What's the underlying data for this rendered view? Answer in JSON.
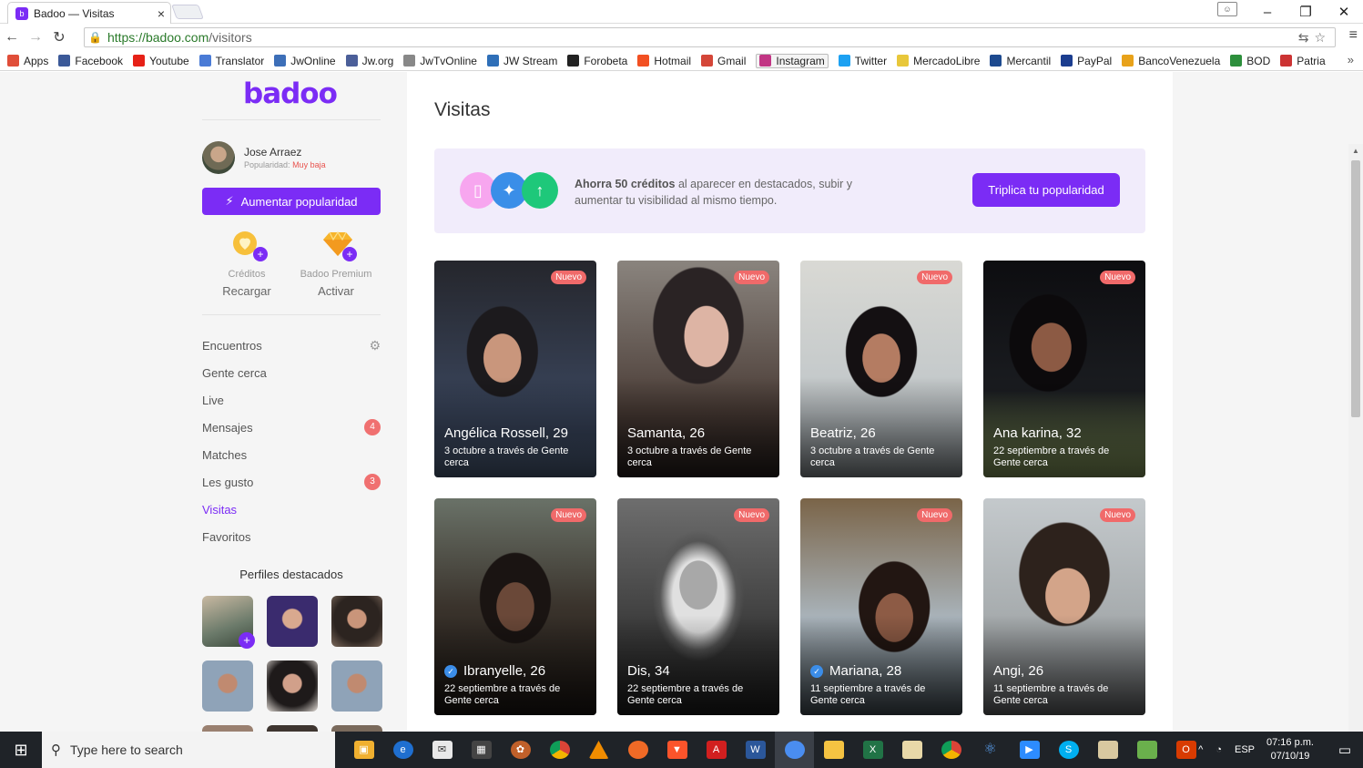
{
  "browser": {
    "tab_title": "Badoo — Visitas",
    "url_host": "https://badoo.com",
    "url_path": "/visitors",
    "bookmarks": [
      {
        "label": "Apps",
        "color": "#e04e39"
      },
      {
        "label": "Facebook",
        "color": "#3b5998"
      },
      {
        "label": "Youtube",
        "color": "#e62117"
      },
      {
        "label": "Translator",
        "color": "#4a7bd6"
      },
      {
        "label": "JwOnline",
        "color": "#3d6fb8"
      },
      {
        "label": "Jw.org",
        "color": "#4b5f99"
      },
      {
        "label": "JwTvOnline",
        "color": "#888888"
      },
      {
        "label": "JW Stream",
        "color": "#2f6fb8"
      },
      {
        "label": "Forobeta",
        "color": "#222222"
      },
      {
        "label": "Hotmail",
        "color": "#f25022"
      },
      {
        "label": "Gmail",
        "color": "#d44638"
      },
      {
        "label": "Instagram",
        "color": "#c13584"
      },
      {
        "label": "Twitter",
        "color": "#1da1f2"
      },
      {
        "label": "MercadoLibre",
        "color": "#e8c73a"
      },
      {
        "label": "Mercantil",
        "color": "#1d4a8f"
      },
      {
        "label": "PayPal",
        "color": "#1b3d8f"
      },
      {
        "label": "BancoVenezuela",
        "color": "#e8a21a"
      },
      {
        "label": "BOD",
        "color": "#2d8f3c"
      },
      {
        "label": "Patria",
        "color": "#cc3333"
      }
    ]
  },
  "sidebar": {
    "logo": "badoo",
    "user_name": "Jose Arraez",
    "popularity_label": "Popularidad:",
    "popularity_value": "Muy baja",
    "boost_button": "Aumentar popularidad",
    "credits_title": "Créditos",
    "credits_action": "Recargar",
    "premium_title": "Badoo Premium",
    "premium_action": "Activar",
    "nav": [
      {
        "label": "Encuentros",
        "badge": ""
      },
      {
        "label": "Gente cerca",
        "badge": ""
      },
      {
        "label": "Live",
        "badge": ""
      },
      {
        "label": "Mensajes",
        "badge": "4"
      },
      {
        "label": "Matches",
        "badge": ""
      },
      {
        "label": "Les gusto",
        "badge": "3"
      },
      {
        "label": "Visitas",
        "badge": ""
      },
      {
        "label": "Favoritos",
        "badge": ""
      }
    ],
    "featured_title": "Perfiles destacados"
  },
  "main": {
    "title": "Visitas",
    "promo_bold": "Ahorra 50 créditos",
    "promo_text": " al aparecer en destacados, subir y aumentar tu visibilidad al mismo tiempo.",
    "promo_button": "Triplica tu popularidad",
    "cards": [
      {
        "name": "Angélica Rossell, 29",
        "meta": "3 octubre a través de Gente cerca",
        "badge": "Nuevo",
        "verified": false
      },
      {
        "name": "Samanta, 26",
        "meta": "3 octubre a través de Gente cerca",
        "badge": "Nuevo",
        "verified": false
      },
      {
        "name": "Beatriz, 26",
        "meta": "3 octubre a través de Gente cerca",
        "badge": "Nuevo",
        "verified": false
      },
      {
        "name": "Ana karina, 32",
        "meta": "22 septiembre a través de Gente cerca",
        "badge": "Nuevo",
        "verified": false
      },
      {
        "name": "Ibranyelle, 26",
        "meta": "22 septiembre a través de Gente cerca",
        "badge": "Nuevo",
        "verified": true
      },
      {
        "name": "Dis, 34",
        "meta": "22 septiembre a través de Gente cerca",
        "badge": "Nuevo",
        "verified": false
      },
      {
        "name": "Mariana, 28",
        "meta": "11 septiembre a través de Gente cerca",
        "badge": "Nuevo",
        "verified": true
      },
      {
        "name": "Angi, 26",
        "meta": "11 septiembre a través de Gente cerca",
        "badge": "Nuevo",
        "verified": false
      }
    ]
  },
  "taskbar": {
    "search_placeholder": "Type here to search",
    "lang": "ESP",
    "time": "07:16 p.m.",
    "date": "07/10/19"
  },
  "colors": {
    "brand": "#7b2cf5",
    "badge": "#f06a6a"
  }
}
